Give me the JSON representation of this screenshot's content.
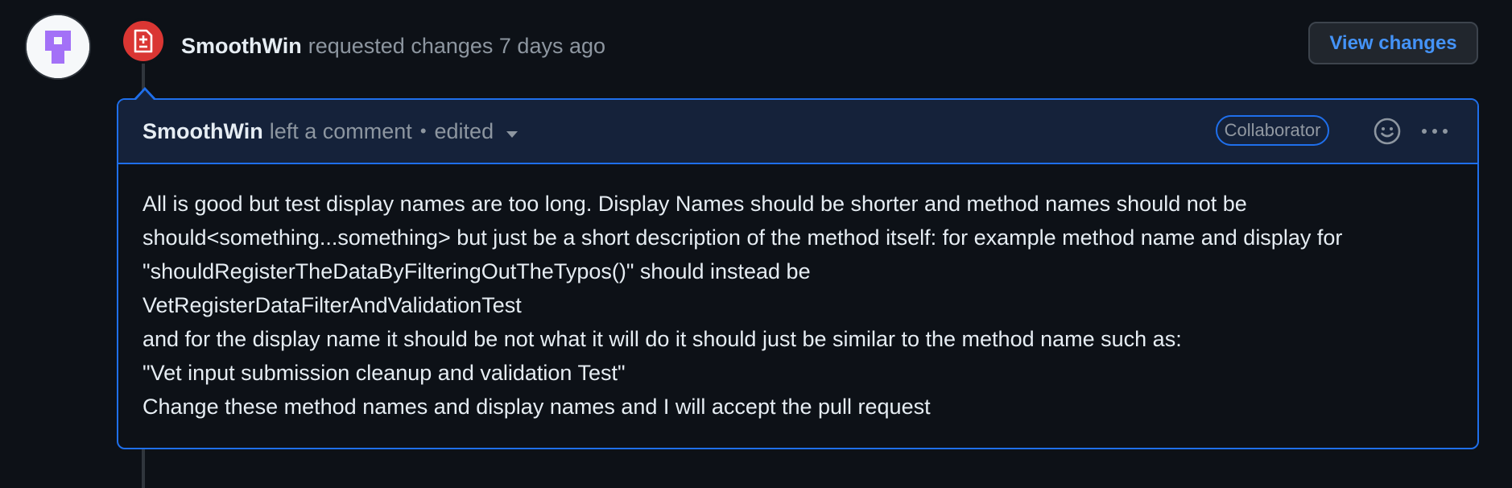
{
  "reviewer": {
    "name": "SmoothWin"
  },
  "review_event": {
    "author": "SmoothWin",
    "text": "requested changes 7 days ago",
    "status_icon": "file-diff-icon",
    "status_color": "#da3633"
  },
  "view_changes_label": "View changes",
  "comment": {
    "author": "SmoothWin",
    "meta": "left a comment",
    "separator": "•",
    "edited": "edited",
    "role_badge": "Collaborator",
    "lines": [
      "All is good but test display names are too long. Display Names should be shorter and method names should not be",
      "should<something...something> but just be a short description of the method itself: for example method name and display for",
      "\"shouldRegisterTheDataByFilteringOutTheTypos()\" should instead be",
      "VetRegisterDataFilterAndValidationTest",
      "and for the display name it should be not what it will do it should just be similar to the method name such as:",
      "\"Vet input submission cleanup and validation Test\"",
      "Change these method names and display names and I will accept the pull request"
    ]
  },
  "colors": {
    "background": "#0d1117",
    "accent_blue": "#1f6feb",
    "link_blue": "#4493f8",
    "header_bg": "#15223a",
    "avatar_purple": "#8957e5"
  }
}
